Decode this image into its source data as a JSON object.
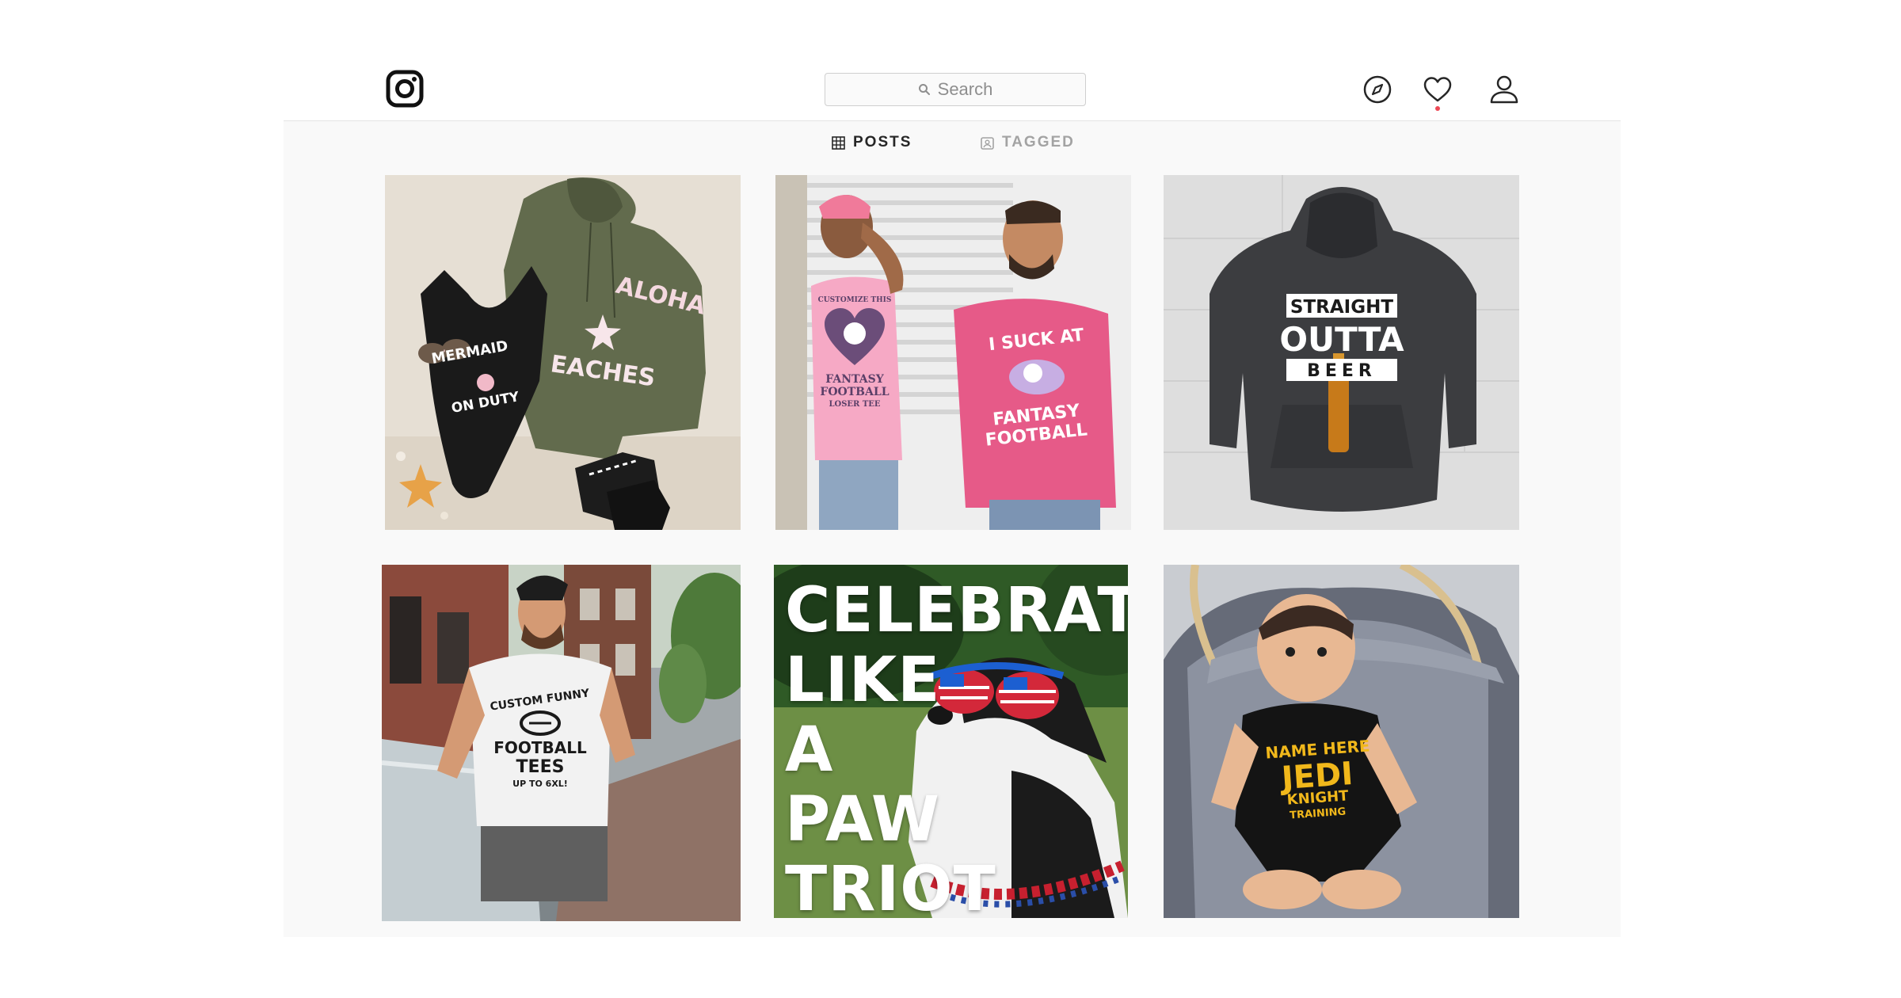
{
  "header": {
    "logo_icon": "instagram-logo-icon",
    "search": {
      "placeholder": "Search",
      "icon": "search-icon"
    },
    "nav_icons": [
      "compass-icon",
      "heart-icon",
      "user-icon"
    ],
    "notification_dot_color": "#ed4956"
  },
  "tabs": [
    {
      "label": "POSTS",
      "icon": "grid-icon",
      "active": true
    },
    {
      "label": "TAGGED",
      "icon": "tagged-icon",
      "active": false
    }
  ],
  "posts": [
    {
      "texts": [
        "ALOHA",
        "BEACHES",
        "MERMAID",
        "- ● -",
        "ON DUTY"
      ]
    },
    {
      "texts": [
        "CUSTOMIZE THIS",
        "FANTASY",
        "FOOTBALL",
        "LOSER TEE",
        "I SUCK AT",
        "FANTASY",
        "FOOTBALL"
      ]
    },
    {
      "texts": [
        "STRAIGHT",
        "OUTTA",
        "BEER"
      ]
    },
    {
      "texts": [
        "CUSTOM FUNNY",
        "FOOTBALL",
        "TEES",
        "UP TO 6XL!"
      ]
    },
    {
      "texts": [
        "CELEBRATE",
        "LIKE",
        "A",
        "PAW",
        "TRIOT"
      ]
    },
    {
      "texts": [
        "NAME HERE",
        "JEDI",
        "KNIGHT",
        "TRAINING"
      ]
    }
  ]
}
